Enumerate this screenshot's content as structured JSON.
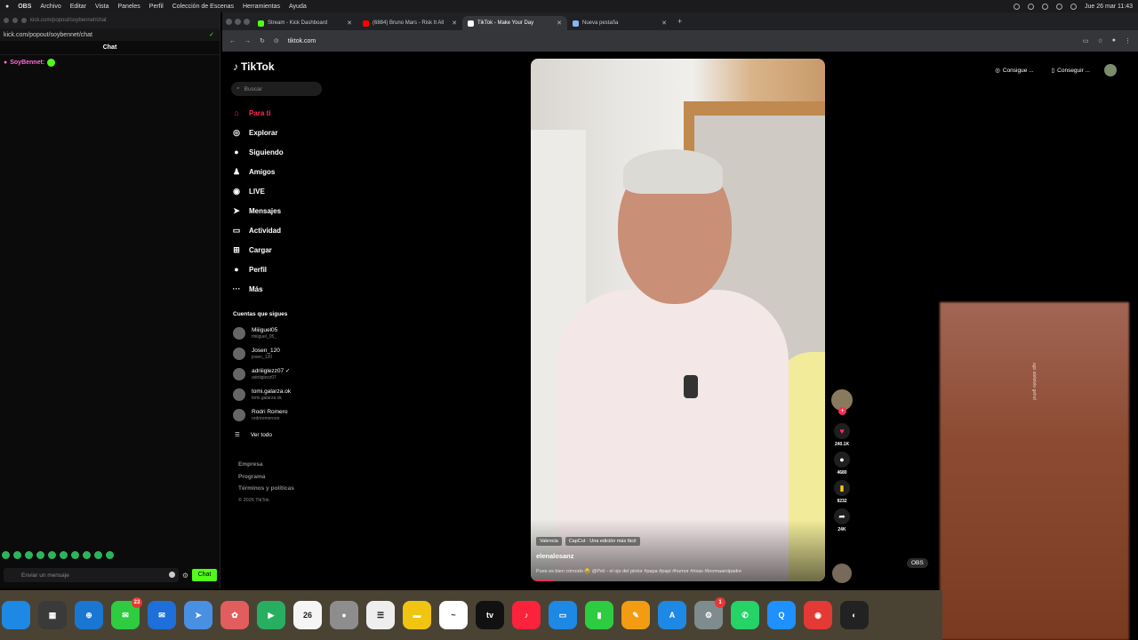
{
  "menubar": {
    "app": "OBS",
    "items": [
      "Archivo",
      "Editar",
      "Vista",
      "Paneles",
      "Perfil",
      "Colección de Escenas",
      "Herramientas",
      "Ayuda"
    ],
    "datetime": "Jue 26 mar 11:43"
  },
  "kick": {
    "window_title": "kick.com/popout/soybennet/chat",
    "url": "kick.com/popout/soybennet/chat",
    "chat_title": "Chat",
    "message_user": "SoyBennet:",
    "input_placeholder": "Enviar un mensaje",
    "chat_button": "Chat"
  },
  "chrome": {
    "tabs": [
      {
        "label": "Stream - Kick Dashboard",
        "color": "#53fc18"
      },
      {
        "label": "(6884) Bruno Mars - Risk It All",
        "color": "#ff0000"
      },
      {
        "label": "TikTok - Make Your Day",
        "color": "#ffffff"
      },
      {
        "label": "Nueva pestaña",
        "color": "#8ab4f8"
      }
    ],
    "url": "tiktok.com"
  },
  "tiktok": {
    "logo": "TikTok",
    "search_placeholder": "Buscar",
    "nav": [
      {
        "label": "Para ti",
        "icon": "⌂"
      },
      {
        "label": "Explorar",
        "icon": "◎"
      },
      {
        "label": "Siguiendo",
        "icon": "●"
      },
      {
        "label": "Amigos",
        "icon": "♟"
      },
      {
        "label": "LIVE",
        "icon": "◉"
      },
      {
        "label": "Mensajes",
        "icon": "➤"
      },
      {
        "label": "Actividad",
        "icon": "▭"
      },
      {
        "label": "Cargar",
        "icon": "⊞"
      },
      {
        "label": "Perfil",
        "icon": "●"
      },
      {
        "label": "Más",
        "icon": "···"
      }
    ],
    "following_title": "Cuentas que sigues",
    "following": [
      {
        "name": "Miiiguel05",
        "handle": "miiiguel_05_"
      },
      {
        "name": "Josen_120",
        "handle": "josen_120"
      },
      {
        "name": "adriiiglezz07 ✓",
        "handle": "adriiiglezz07"
      },
      {
        "name": "tomi.galarza.ok",
        "handle": "tomi.galarza.ok"
      },
      {
        "name": "Rodri Romero",
        "handle": "rodriromerooo"
      }
    ],
    "see_all": "Ver todo",
    "footer": [
      "Empresa",
      "Programa",
      "Términos y políticas"
    ],
    "copyright": "© 2026 TikTok",
    "top_buttons": [
      "Consigue ...",
      "Conseguir ..."
    ],
    "video": {
      "tags": [
        "Valencia",
        "CapCut · Una edición más fácil"
      ],
      "author": "elenalosanz",
      "description": "Pues es bien cómodo 😂 @Peli - el ojo del pintor #papa #papi #humor #risas #bromaamipadre",
      "likes": "240.1K",
      "comments": "4680",
      "saves": "9232",
      "shares": "24K"
    }
  },
  "overlay": {
    "obs_label": "OBS",
    "blur_text": "ago alelelele gelnd"
  },
  "dock": {
    "items": [
      {
        "name": "finder",
        "label": "",
        "color": "#1e88e5"
      },
      {
        "name": "launchpad",
        "label": "▦",
        "color": "#3a3a3a"
      },
      {
        "name": "safari",
        "label": "⊕",
        "color": "#1976d2"
      },
      {
        "name": "messages",
        "label": "✉",
        "color": "#2ecc40",
        "badge": "23"
      },
      {
        "name": "mail",
        "label": "✉",
        "color": "#1e6fd9"
      },
      {
        "name": "maps",
        "label": "➤",
        "color": "#4a90e2"
      },
      {
        "name": "photos",
        "label": "✿",
        "color": "#e25d5d"
      },
      {
        "name": "facetime",
        "label": "▶",
        "color": "#27ae60"
      },
      {
        "name": "calendar",
        "label": "26",
        "color": "#f5f5f5"
      },
      {
        "name": "contacts",
        "label": "●",
        "color": "#8d8d8d"
      },
      {
        "name": "reminders",
        "label": "☰",
        "color": "#eeeeee"
      },
      {
        "name": "notes",
        "label": "▬",
        "color": "#f1c40f"
      },
      {
        "name": "freeform",
        "label": "~",
        "color": "#ffffff"
      },
      {
        "name": "appletv",
        "label": "tv",
        "color": "#111111"
      },
      {
        "name": "music",
        "label": "♪",
        "color": "#fa233b"
      },
      {
        "name": "keynote",
        "label": "▭",
        "color": "#1e88e5"
      },
      {
        "name": "numbers",
        "label": "▮",
        "color": "#2ecc40"
      },
      {
        "name": "pages",
        "label": "✎",
        "color": "#f39c12"
      },
      {
        "name": "appstore",
        "label": "A",
        "color": "#1e88e5"
      },
      {
        "name": "settings",
        "label": "⚙",
        "color": "#7f8c8d",
        "badge": "1"
      },
      {
        "name": "whatsapp",
        "label": "✆",
        "color": "#25d366"
      },
      {
        "name": "quicktime",
        "label": "Q",
        "color": "#1e90ff"
      },
      {
        "name": "chrome",
        "label": "◉",
        "color": "#e53935"
      },
      {
        "name": "obs",
        "label": "◐",
        "color": "#222222"
      }
    ]
  }
}
